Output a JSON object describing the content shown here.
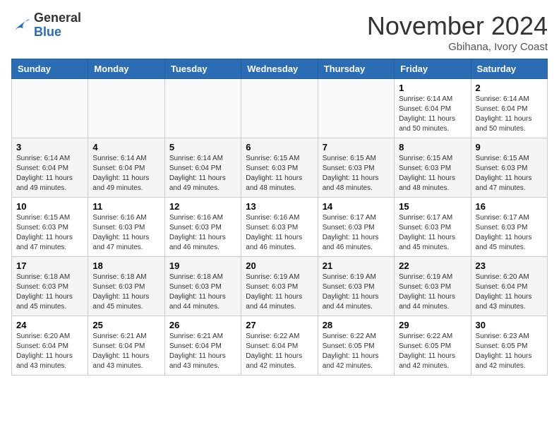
{
  "header": {
    "logo_line1": "General",
    "logo_line2": "Blue",
    "month": "November 2024",
    "location": "Gbihana, Ivory Coast"
  },
  "weekdays": [
    "Sunday",
    "Monday",
    "Tuesday",
    "Wednesday",
    "Thursday",
    "Friday",
    "Saturday"
  ],
  "weeks": [
    [
      {
        "day": "",
        "info": ""
      },
      {
        "day": "",
        "info": ""
      },
      {
        "day": "",
        "info": ""
      },
      {
        "day": "",
        "info": ""
      },
      {
        "day": "",
        "info": ""
      },
      {
        "day": "1",
        "info": "Sunrise: 6:14 AM\nSunset: 6:04 PM\nDaylight: 11 hours\nand 50 minutes."
      },
      {
        "day": "2",
        "info": "Sunrise: 6:14 AM\nSunset: 6:04 PM\nDaylight: 11 hours\nand 50 minutes."
      }
    ],
    [
      {
        "day": "3",
        "info": "Sunrise: 6:14 AM\nSunset: 6:04 PM\nDaylight: 11 hours\nand 49 minutes."
      },
      {
        "day": "4",
        "info": "Sunrise: 6:14 AM\nSunset: 6:04 PM\nDaylight: 11 hours\nand 49 minutes."
      },
      {
        "day": "5",
        "info": "Sunrise: 6:14 AM\nSunset: 6:04 PM\nDaylight: 11 hours\nand 49 minutes."
      },
      {
        "day": "6",
        "info": "Sunrise: 6:15 AM\nSunset: 6:03 PM\nDaylight: 11 hours\nand 48 minutes."
      },
      {
        "day": "7",
        "info": "Sunrise: 6:15 AM\nSunset: 6:03 PM\nDaylight: 11 hours\nand 48 minutes."
      },
      {
        "day": "8",
        "info": "Sunrise: 6:15 AM\nSunset: 6:03 PM\nDaylight: 11 hours\nand 48 minutes."
      },
      {
        "day": "9",
        "info": "Sunrise: 6:15 AM\nSunset: 6:03 PM\nDaylight: 11 hours\nand 47 minutes."
      }
    ],
    [
      {
        "day": "10",
        "info": "Sunrise: 6:15 AM\nSunset: 6:03 PM\nDaylight: 11 hours\nand 47 minutes."
      },
      {
        "day": "11",
        "info": "Sunrise: 6:16 AM\nSunset: 6:03 PM\nDaylight: 11 hours\nand 47 minutes."
      },
      {
        "day": "12",
        "info": "Sunrise: 6:16 AM\nSunset: 6:03 PM\nDaylight: 11 hours\nand 46 minutes."
      },
      {
        "day": "13",
        "info": "Sunrise: 6:16 AM\nSunset: 6:03 PM\nDaylight: 11 hours\nand 46 minutes."
      },
      {
        "day": "14",
        "info": "Sunrise: 6:17 AM\nSunset: 6:03 PM\nDaylight: 11 hours\nand 46 minutes."
      },
      {
        "day": "15",
        "info": "Sunrise: 6:17 AM\nSunset: 6:03 PM\nDaylight: 11 hours\nand 45 minutes."
      },
      {
        "day": "16",
        "info": "Sunrise: 6:17 AM\nSunset: 6:03 PM\nDaylight: 11 hours\nand 45 minutes."
      }
    ],
    [
      {
        "day": "17",
        "info": "Sunrise: 6:18 AM\nSunset: 6:03 PM\nDaylight: 11 hours\nand 45 minutes."
      },
      {
        "day": "18",
        "info": "Sunrise: 6:18 AM\nSunset: 6:03 PM\nDaylight: 11 hours\nand 45 minutes."
      },
      {
        "day": "19",
        "info": "Sunrise: 6:18 AM\nSunset: 6:03 PM\nDaylight: 11 hours\nand 44 minutes."
      },
      {
        "day": "20",
        "info": "Sunrise: 6:19 AM\nSunset: 6:03 PM\nDaylight: 11 hours\nand 44 minutes."
      },
      {
        "day": "21",
        "info": "Sunrise: 6:19 AM\nSunset: 6:03 PM\nDaylight: 11 hours\nand 44 minutes."
      },
      {
        "day": "22",
        "info": "Sunrise: 6:19 AM\nSunset: 6:03 PM\nDaylight: 11 hours\nand 44 minutes."
      },
      {
        "day": "23",
        "info": "Sunrise: 6:20 AM\nSunset: 6:04 PM\nDaylight: 11 hours\nand 43 minutes."
      }
    ],
    [
      {
        "day": "24",
        "info": "Sunrise: 6:20 AM\nSunset: 6:04 PM\nDaylight: 11 hours\nand 43 minutes."
      },
      {
        "day": "25",
        "info": "Sunrise: 6:21 AM\nSunset: 6:04 PM\nDaylight: 11 hours\nand 43 minutes."
      },
      {
        "day": "26",
        "info": "Sunrise: 6:21 AM\nSunset: 6:04 PM\nDaylight: 11 hours\nand 43 minutes."
      },
      {
        "day": "27",
        "info": "Sunrise: 6:22 AM\nSunset: 6:04 PM\nDaylight: 11 hours\nand 42 minutes."
      },
      {
        "day": "28",
        "info": "Sunrise: 6:22 AM\nSunset: 6:05 PM\nDaylight: 11 hours\nand 42 minutes."
      },
      {
        "day": "29",
        "info": "Sunrise: 6:22 AM\nSunset: 6:05 PM\nDaylight: 11 hours\nand 42 minutes."
      },
      {
        "day": "30",
        "info": "Sunrise: 6:23 AM\nSunset: 6:05 PM\nDaylight: 11 hours\nand 42 minutes."
      }
    ]
  ]
}
